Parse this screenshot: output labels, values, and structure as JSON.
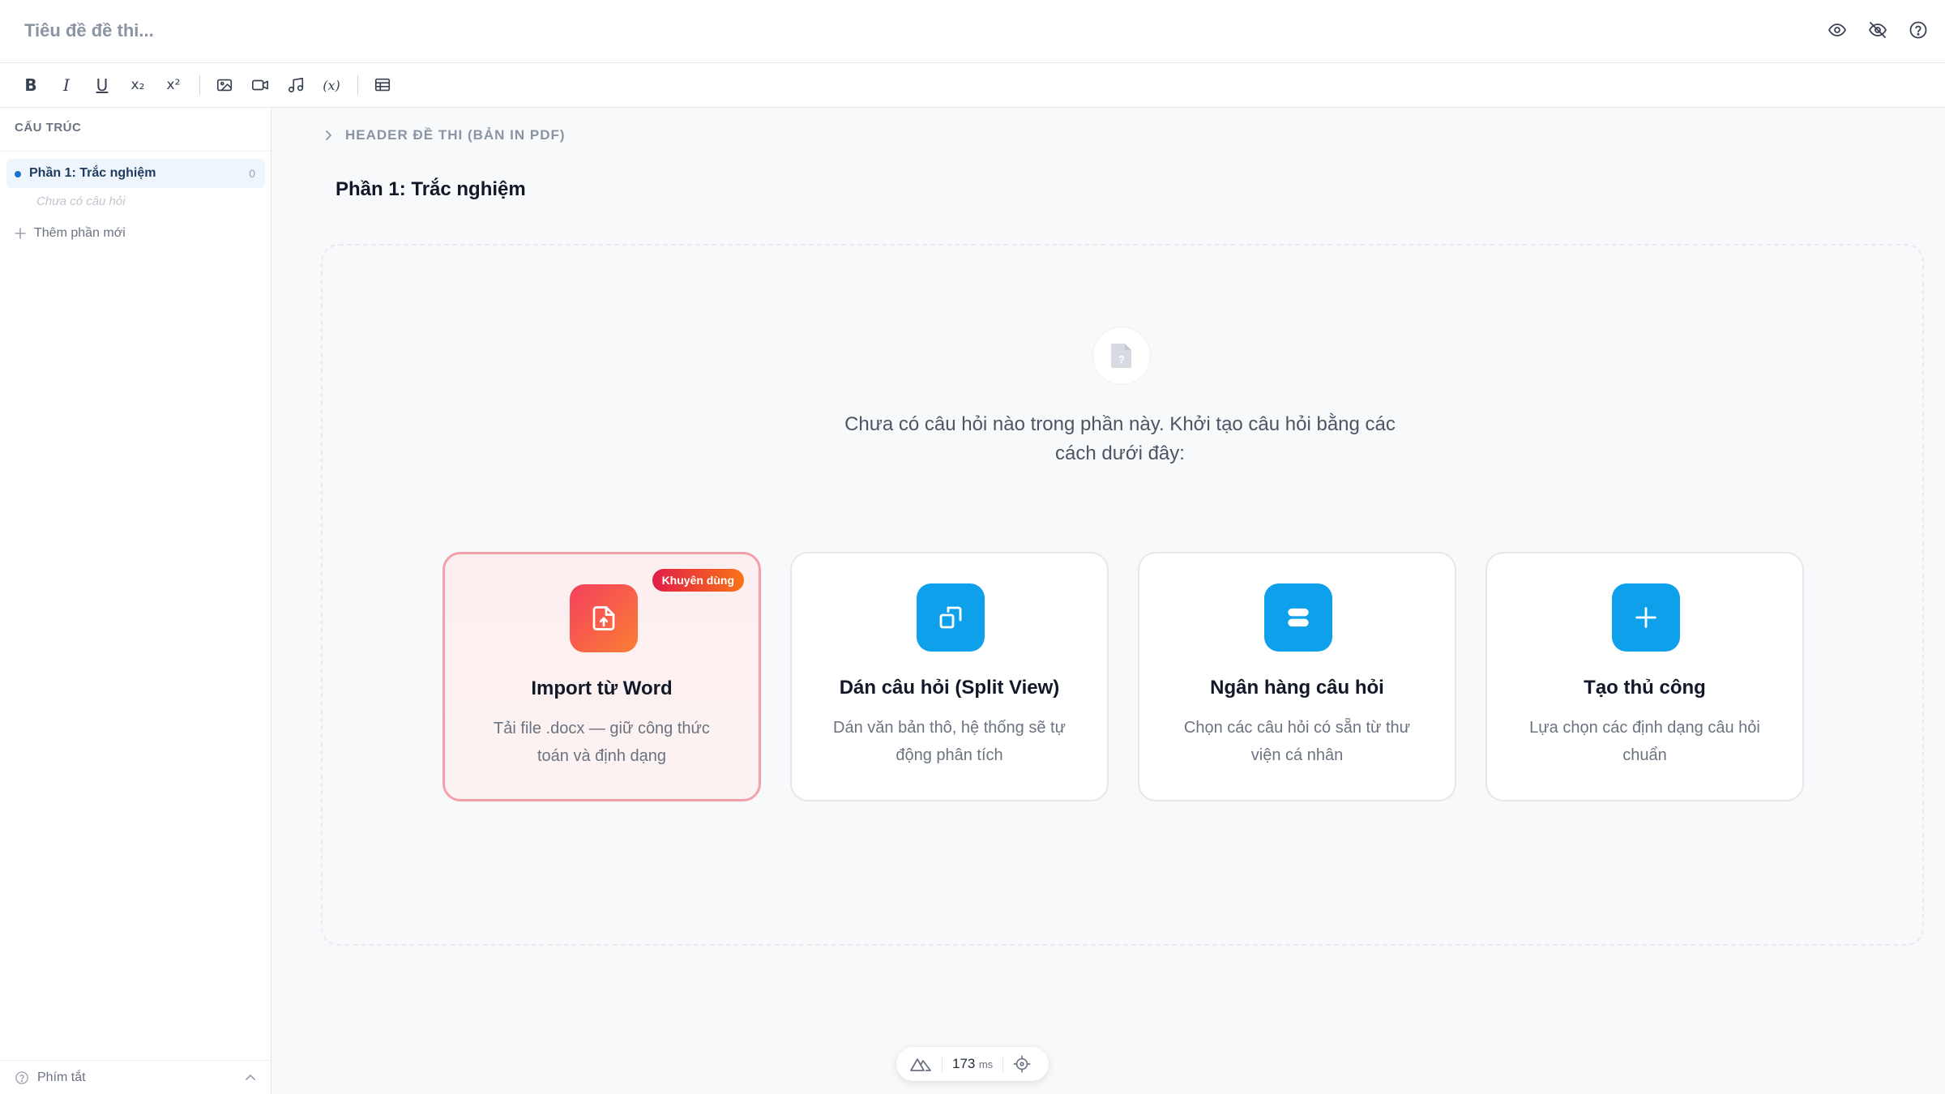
{
  "topbar": {
    "title_placeholder": "Tiêu đề đề thi...",
    "icons": [
      "eye-icon",
      "eye-off-icon",
      "help-icon"
    ]
  },
  "toolbar": {
    "bold": "B",
    "italic": "I",
    "underline": "U",
    "subscript": "x₂",
    "superscript": "x²",
    "formula": "(x)"
  },
  "sidebar": {
    "heading": "CẤU TRÚC",
    "items": [
      {
        "label": "Phần 1: Trắc nghiệm",
        "count": "0",
        "empty_text": "Chưa có câu hỏi"
      }
    ],
    "add_label": "Thêm phần mới",
    "footer_label": "Phím tắt"
  },
  "main": {
    "header_toggle": "HEADER ĐỀ THI (BẢN IN PDF)",
    "section_title": "Phần 1: Trắc nghiệm",
    "empty_text": "Chưa có câu hỏi nào trong phần này. Khởi tạo câu hỏi bằng các cách dưới đây:",
    "cards": [
      {
        "title": "Import từ Word",
        "desc": "Tải file .docx — giữ công thức toán và định dạng",
        "badge": "Khuyên dùng"
      },
      {
        "title": "Dán câu hỏi (Split View)",
        "desc": "Dán văn bản thô, hệ thống sẽ tự động phân tích"
      },
      {
        "title": "Ngân hàng câu hỏi",
        "desc": "Chọn các câu hỏi có sẵn từ thư viện cá nhân"
      },
      {
        "title": "Tạo thủ công",
        "desc": "Lựa chọn các định dạng câu hỏi chuẩn"
      }
    ]
  },
  "perf": {
    "value": "173",
    "unit": "ms"
  },
  "colors": {
    "accent": "#0ea0ea",
    "recommended_from": "#f43f5e",
    "recommended_to": "#fb7f34"
  }
}
